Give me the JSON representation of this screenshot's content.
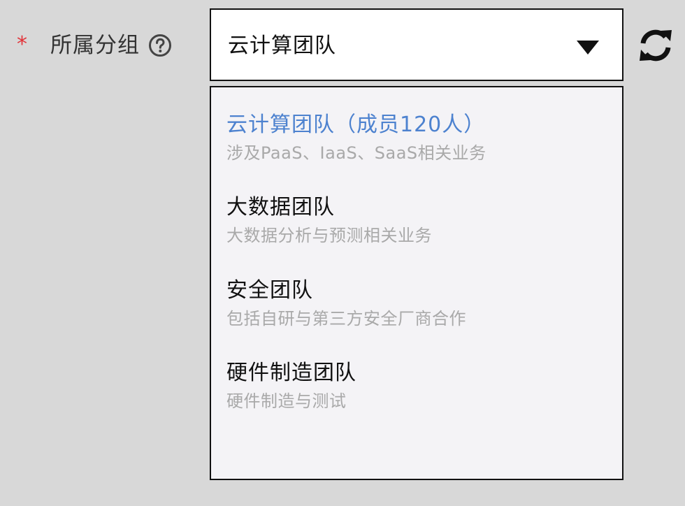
{
  "field": {
    "required_mark": "*",
    "label": "所属分组"
  },
  "icons": {
    "help": "help-circle-icon",
    "caret": "caret-down-icon",
    "refresh": "refresh-icon"
  },
  "select": {
    "value": "云计算团队"
  },
  "dropdown": {
    "options": [
      {
        "title": "云计算团队（成员120人）",
        "desc": "涉及PaaS、IaaS、SaaS相关业务",
        "selected": true
      },
      {
        "title": "大数据团队",
        "desc": "大数据分析与预测相关业务",
        "selected": false
      },
      {
        "title": "安全团队",
        "desc": "包括自研与第三方安全厂商合作",
        "selected": false
      },
      {
        "title": "硬件制造团队",
        "desc": "硬件制造与测试",
        "selected": false
      }
    ]
  },
  "colors": {
    "required": "#e2343a",
    "selected_option": "#4d82cf",
    "description": "#a9a9a9",
    "background": "#d8d8d8",
    "dropdown_background": "#f4f3f6"
  }
}
